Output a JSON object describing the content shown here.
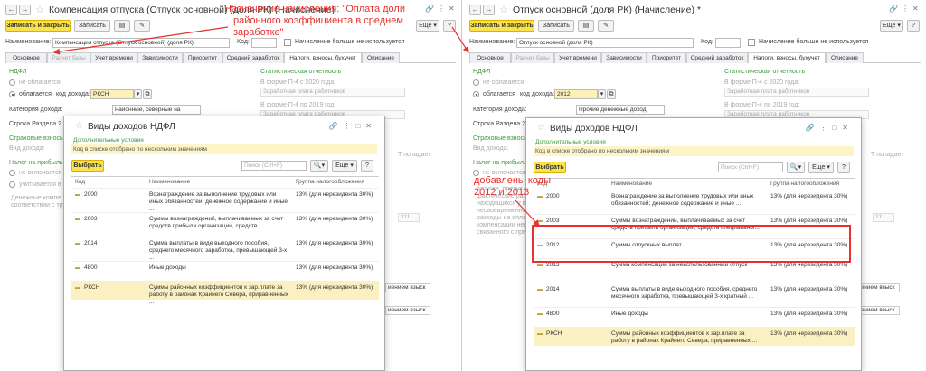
{
  "left": {
    "title": "Компенсация отпуска (Отпуск основной) (доля РК) (Начисление)",
    "toolbar": {
      "save_close": "Записать и закрыть",
      "save": "Записать",
      "more": "Еще"
    },
    "name_label": "Наименование:",
    "name_value": "Компенсация отпуска (Отпуск основной) (доля РК)",
    "code_label": "Код:",
    "no_use_label": "Начисление больше не используется",
    "tabs": [
      "Основное",
      "Расчет базы",
      "Учет времени",
      "Зависимости",
      "Приоритет",
      "Средний заработок",
      "Налоги, взносы, бухучет",
      "Описание"
    ],
    "ndfl": "НДФЛ",
    "not_taxed": "не облагается",
    "taxed": "облагается",
    "income_code_label": "код дохода:",
    "income_code_value": "РКСН",
    "income_cat_label": "Категория дохода:",
    "income_cat_value": "Районные, северные на",
    "section_row": "Строка Раздела 2",
    "insurance": "Страховые взносы",
    "income_kind": "Вид дохода:",
    "profit_tax": "Налог на прибыль",
    "not_included": "не включается",
    "included": "учитывается в",
    "cash_comp": "Денежные компе",
    "according": "соответствии с труд",
    "stat": "Статистическая отчетность",
    "p4_before": "В форме П-4 с 2020 года:",
    "p4_before_value": "Заработная плата работников",
    "p4_2019": "В форме П-4 по 2019 год:",
    "p4_2019_value": "Заработная плата работников",
    "popadaet": "Т попадает"
  },
  "right": {
    "title": "Отпуск основной (доля РК) (Начисление) *",
    "toolbar": {
      "save_close": "Записать и закрыть",
      "save": "Записать",
      "more": "Еще"
    },
    "name_label": "Наименование:",
    "name_value": "Отпуск основной (доля РК)",
    "code_label": "Код:",
    "no_use_label": "Начисление больше не используется",
    "tabs": [
      "Основное",
      "Расчет базы",
      "Учет времени",
      "Зависимости",
      "Приоритет",
      "Средний заработок",
      "Налоги, взносы, бухучет",
      "Описание"
    ],
    "ndfl": "НДФЛ",
    "not_taxed": "не облагается",
    "taxed": "облагается",
    "income_code_label": "код дохода:",
    "income_code_value": "2012",
    "income_cat_label": "Категория дохода:",
    "income_cat_value": "Прочие денежные доход",
    "section_row": "Строка Раздела 2",
    "insurance": "Страховые взносы",
    "income_kind": "Вид дохода:",
    "profit_tax": "Налог на прибыль",
    "not_included": "не включается",
    "stat": "Статистическая отчетность",
    "p4_before": "В форме П-4 с 2020 года:",
    "p4_before_value": "Заработная плата работников",
    "p4_2019": "В форме П-4 по 2019 год:",
    "p4_2019_value": "Заработная плата работников",
    "popadaet": "Т попадает",
    "extra_text": [
      "отпуска, предус",
      "фактические расх",
      "находящихся у пре",
      "несвоевременной",
      "расходы на оплат",
      "компенсации неи",
      "связанного с прих"
    ]
  },
  "dialog": {
    "title": "Виды доходов НДФЛ",
    "conditions": "Дополнительные условия",
    "filter": "Код в списке отобрано по нескольким значениям",
    "select": "Выбрать",
    "search_placeholder": "Поиск (Ctrl+F)",
    "more": "Еще",
    "help": "?",
    "col_code": "Код",
    "col_name": "Наименование",
    "col_group": "Группа налогообложения",
    "left_rows": [
      {
        "code": "2000",
        "name": "Вознаграждение за выполнение трудовых или иных обязанностей; денежное содержание и иные ...",
        "group": "13% (для нерезидента 30%)"
      },
      {
        "code": "2003",
        "name": "Суммы вознаграждений, выплачиваемых за счет средств прибыли организации, средств ...",
        "group": "13% (для нерезидента 30%)"
      },
      {
        "code": "2014",
        "name": "Сумма выплаты в виде выходного пособия, среднего месячного заработка, превышающей 3-х ...",
        "group": "13% (для нерезидента 30%)"
      },
      {
        "code": "4800",
        "name": "Иные доходы",
        "group": "13% (для нерезидента 30%)"
      },
      {
        "code": "РКСН",
        "name": "Суммы районных коэффициентов к зар.плате за работу в районах Крайнего Севера, приравненных ...",
        "group": "13% (для нерезидента 30%)"
      }
    ],
    "right_rows": [
      {
        "code": "2000",
        "name": "Вознаграждение за выполнение трудовых или иных обязанностей; денежное содержание и иные ...",
        "group": "13% (для нерезидента 30%)"
      },
      {
        "code": "2003",
        "name": "Суммы вознаграждений, выплачиваемых за счет средств прибыли организации, средств специальног...",
        "group": "13% (для нерезидента 30%)"
      },
      {
        "code": "2012",
        "name": "Суммы отпускных выплат",
        "group": "13% (для нерезидента 30%)"
      },
      {
        "code": "2013",
        "name": "Сумма компенсации за неиспользованный отпуск",
        "group": "13% (для нерезидента 30%)"
      },
      {
        "code": "2014",
        "name": "Сумма выплаты в виде выходного пособия, среднего месячного заработка, превышающей 3-х кратный ...",
        "group": "13% (для нерезидента 30%)"
      },
      {
        "code": "4800",
        "name": "Иные доходы",
        "group": "13% (для нерезидента 30%)"
      },
      {
        "code": "РКСН",
        "name": "Суммы районных коэффициентов к зар.плате за работу в районах Крайнего Севера, приравненных ...",
        "group": "13% (для нерезидента 30%)"
      }
    ]
  },
  "annotations": {
    "top": "Назначение начисления: \"Оплата доли районного коэффициента в среднем заработке\"",
    "top_line1": "Назначение начисления: \"Оплата доли",
    "top_line2": "районного коэффициента в среднем",
    "top_line3": "заработке\"",
    "codes": "добавлены коды 2012 и 2013",
    "codes_line1": "добавлены коды",
    "codes_line2": "2012 и 2013"
  },
  "lower_fields": {
    "code_211": "211",
    "vznos": "иением взыск"
  },
  "colors": {
    "accent_yellow": "#fbe14a",
    "red": "#e8312e",
    "green": "#3a9a3a",
    "selected_row": "#fbf0c1"
  }
}
